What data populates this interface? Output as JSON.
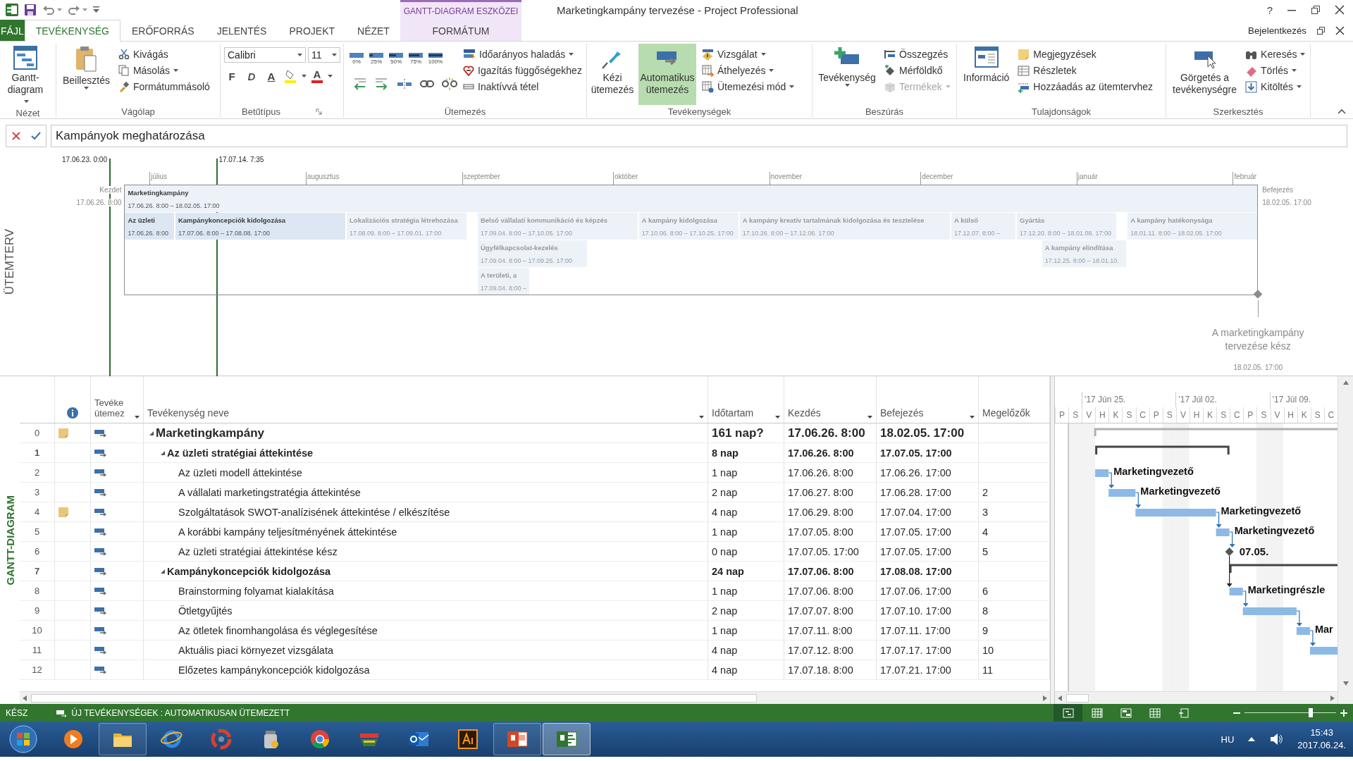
{
  "title_bar": {
    "contextual_label": "GANTT-DIAGRAM ESZKÖZEI",
    "title": "Marketingkampány tervezése - Project Professional",
    "help": "?"
  },
  "tabs": [
    {
      "label": "FÁJL",
      "kind": "file",
      "selected": false
    },
    {
      "label": "TEVÉKENYSÉG",
      "kind": "normal",
      "selected": true
    },
    {
      "label": "ERŐFORRÁS",
      "kind": "normal",
      "selected": false
    },
    {
      "label": "JELENTÉS",
      "kind": "normal",
      "selected": false
    },
    {
      "label": "PROJEKT",
      "kind": "normal",
      "selected": false
    },
    {
      "label": "NÉZET",
      "kind": "normal",
      "selected": false
    },
    {
      "label": "FORMÁTUM",
      "kind": "contextual",
      "selected": false
    }
  ],
  "account": "Bejelentkezés",
  "ribbon": [
    {
      "kind": "view",
      "label": "Nézet",
      "items": [
        {
          "label": "Gantt-diagram"
        }
      ]
    },
    {
      "kind": "clipboard",
      "label": "Vágólap",
      "items": [
        {
          "label": "Beillesztés"
        },
        {
          "label": "Kivágás"
        },
        {
          "label": "Másolás"
        },
        {
          "label": "Formátummásoló"
        }
      ]
    },
    {
      "kind": "font",
      "label": "Betűtípus",
      "font": "Calibri",
      "size": "11",
      "buttons": [
        "F",
        "D",
        "A"
      ],
      "font_color": "A"
    },
    {
      "kind": "schedule",
      "label": "Ütemezés",
      "progress": [
        "0%",
        "25%",
        "50%",
        "75%",
        "100%"
      ],
      "items": [
        {
          "label": "Időarányos haladás"
        },
        {
          "label": "Igazítás függőségekhez"
        },
        {
          "label": "Inaktívvá tétel"
        }
      ]
    },
    {
      "kind": "tasks",
      "label": "Tevékenységek",
      "modes": [
        {
          "label": "Kézi ütemezés",
          "selected": false
        },
        {
          "label": "Automatikus ütemezés",
          "selected": true
        }
      ],
      "items": [
        {
          "label": "Vizsgálat"
        },
        {
          "label": "Áthelyezés"
        },
        {
          "label": "Ütemezési mód"
        }
      ]
    },
    {
      "kind": "insert",
      "label": "Beszúrás",
      "large": "Tevékenység",
      "items": [
        {
          "label": "Összegzés",
          "disabled": false
        },
        {
          "label": "Mérföldkő",
          "disabled": false
        },
        {
          "label": "Termékek",
          "disabled": true
        }
      ]
    },
    {
      "kind": "properties",
      "label": "Tulajdonságok",
      "large": "Információ",
      "items": [
        {
          "label": "Megjegyzések"
        },
        {
          "label": "Részletek"
        },
        {
          "label": "Hozzáadás az ütemtervhez"
        }
      ]
    },
    {
      "kind": "editing",
      "label": "Szerkesztés",
      "large": "Görgetés a tevékenységre",
      "items": [
        {
          "label": "Keresés"
        },
        {
          "label": "Törlés"
        },
        {
          "label": "Kitöltés"
        }
      ]
    }
  ],
  "formula_bar": {
    "value": "Kampányok meghatározása"
  },
  "timeline": {
    "label": "ÜTEMTERV",
    "range_start": "17.06.23. 0:00",
    "range_end": "17.07.14. 7:35",
    "months": [
      "július",
      "augusztus",
      "szeptember",
      "október",
      "november",
      "december",
      "január",
      "február"
    ],
    "start_label": "Kezdet",
    "start_date": "17.06.26. 8:00",
    "finish_label": "Befejezés",
    "finish_date": "18.02.05. 17:00",
    "project": {
      "title": "Marketingkampány",
      "dates": "17.06.26. 8:00 – 18.02.05. 17:00"
    },
    "items": [
      {
        "title": "Az üzleti",
        "dates": "17.06.26. 8:00",
        "dimmed": false
      },
      {
        "title": "Kampánykoncepciók kidolgozása",
        "dates": "17.07.06. 8:00 – 17.08.08. 17:00",
        "dimmed": false
      },
      {
        "title": "Lokalizációs stratégia létrehozása",
        "dates": "17.08.09. 8:00 – 17.09.01. 17:00",
        "dimmed": true
      },
      {
        "title": "Belső vállalati kommunikáció és képzés",
        "dates": "17.09.04. 8:00 – 17.10.05. 17:00",
        "dimmed": true
      },
      {
        "title": "Ügyfélkapcsolat-kezelés",
        "dates": "17.09.04. 8:00 – 17.09.25. 17:00",
        "dimmed": true
      },
      {
        "title": "A területi, a",
        "dates": "17.09.04. 8:00 –",
        "dimmed": true
      },
      {
        "title": "A kampány kidolgozása",
        "dates": "17.10.06. 8:00 – 17.10.25. 17:00",
        "dimmed": true
      },
      {
        "title": "A kampány kreatív tartalmának kidolgozása és tesztelése",
        "dates": "17.10.26. 8:00 – 17.12.06. 17:00",
        "dimmed": true
      },
      {
        "title": "A külső",
        "dates": "17.12.07. 8:00 –",
        "dimmed": true
      },
      {
        "title": "Gyártás",
        "dates": "17.12.20. 8:00 – 18.01.08. 17:00",
        "dimmed": true
      },
      {
        "title": "A kampány elindítása",
        "dates": "17.12.25. 8:00 – 18.01.10.",
        "dimmed": true
      },
      {
        "title": "A kampány hatékonysága",
        "dates": "18.01.11. 8:00 – 18.02.05. 17:00",
        "dimmed": true
      }
    ],
    "milestone": {
      "title": "A marketingkampány tervezése kész",
      "date": "18.02.05. 17:00"
    }
  },
  "table": {
    "label": "GANTT-DIAGRAM",
    "columns": [
      {
        "kind": "info"
      },
      {
        "kind": "mode",
        "label": "Tevéke ütemez"
      },
      {
        "kind": "name",
        "label": "Tevékenység neve"
      },
      {
        "kind": "duration",
        "label": "Időtartam"
      },
      {
        "kind": "start",
        "label": "Kezdés"
      },
      {
        "kind": "finish",
        "label": "Befejezés"
      },
      {
        "kind": "pred",
        "label": "Megelőzők"
      }
    ],
    "rows": [
      {
        "id": "0",
        "name": "Marketingkampány",
        "duration": "161 nap?",
        "start": "17.06.26. 8:00",
        "finish": "18.02.05. 17:00",
        "kind": "project",
        "note": true,
        "expanded": true,
        "children": [
          {
            "id": "1",
            "name": "Az üzleti stratégiai áttekintése",
            "duration": "8 nap",
            "start": "17.06.26. 8:00",
            "finish": "17.07.05. 17:00",
            "kind": "summary",
            "note": false,
            "expanded": true,
            "children": [
              {
                "id": "2",
                "name": "Az üzleti modell áttekintése",
                "duration": "1 nap",
                "start": "17.06.26. 8:00",
                "finish": "17.06.26. 17:00",
                "kind": "task",
                "note": false,
                "bar_label": "Marketingvezető"
              },
              {
                "id": "3",
                "name": "A vállalati marketingstratégia áttekintése",
                "duration": "2 nap",
                "start": "17.06.27. 8:00",
                "finish": "17.06.28. 17:00",
                "pred": "2",
                "kind": "task",
                "note": false,
                "bar_label": "Marketingvezető"
              },
              {
                "id": "4",
                "name": "Szolgáltatások SWOT-analízisének áttekintése / elkészítése",
                "duration": "4 nap",
                "start": "17.06.29. 8:00",
                "finish": "17.07.04. 17:00",
                "pred": "3",
                "kind": "task",
                "note": true,
                "bar_label": "Marketingvezető"
              },
              {
                "id": "5",
                "name": "A korábbi kampány teljesítményének áttekintése",
                "duration": "1 nap",
                "start": "17.07.05. 8:00",
                "finish": "17.07.05. 17:00",
                "pred": "4",
                "kind": "task",
                "note": false,
                "bar_label": "Marketingvezető"
              },
              {
                "id": "6",
                "name": "Az üzleti stratégiai áttekintése kész",
                "duration": "0 nap",
                "start": "17.07.05. 17:00",
                "finish": "17.07.05. 17:00",
                "pred": "5",
                "kind": "milestone",
                "note": false,
                "bar_label": "07.05."
              }
            ]
          },
          {
            "id": "7",
            "name": "Kampánykoncepciók kidolgozása",
            "duration": "24 nap",
            "start": "17.07.06. 8:00",
            "finish": "17.08.08. 17:00",
            "kind": "summary",
            "note": false,
            "expanded": true,
            "children": [
              {
                "id": "8",
                "name": "Brainstorming folyamat kialakítása",
                "duration": "1 nap",
                "start": "17.07.06. 8:00",
                "finish": "17.07.06. 17:00",
                "pred": "6",
                "kind": "task",
                "note": false,
                "bar_label": "Marketingrészle"
              },
              {
                "id": "9",
                "name": "Ötletgyűjtés",
                "duration": "2 nap",
                "start": "17.07.07. 8:00",
                "finish": "17.07.10. 17:00",
                "pred": "8",
                "kind": "task",
                "note": false
              },
              {
                "id": "10",
                "name": "Az ötletek finomhangolása és véglegesítése",
                "duration": "1 nap",
                "start": "17.07.11. 8:00",
                "finish": "17.07.11. 17:00",
                "pred": "9",
                "kind": "task",
                "note": false,
                "bar_label": "Mar"
              },
              {
                "id": "11",
                "name": "Aktuális piaci környezet vizsgálata",
                "duration": "4 nap",
                "start": "17.07.12. 8:00",
                "finish": "17.07.17. 17:00",
                "pred": "10",
                "kind": "task",
                "note": false
              },
              {
                "id": "12",
                "name": "Előzetes kampánykoncepciók kidolgozása",
                "duration": "4 nap",
                "start": "17.07.18. 8:00",
                "finish": "17.07.21. 17:00",
                "pred": "11",
                "kind": "task",
                "note": false
              }
            ]
          }
        ]
      }
    ]
  },
  "gantt": {
    "weeks": [
      "'17 Jún 25.",
      "'17 Júl 02.",
      "'17 Júl 09."
    ],
    "days": [
      "P",
      "S",
      "V",
      "H",
      "K",
      "S",
      "C",
      "P",
      "S",
      "V",
      "H",
      "K",
      "S",
      "C",
      "P",
      "S",
      "V",
      "H",
      "K",
      "S",
      "C"
    ]
  },
  "status_bar": {
    "ready": "KÉSZ",
    "new_tasks": "ÚJ TEVÉKENYSÉGEK : AUTOMATIKUSAN ÜTEMEZETT",
    "views": [
      {
        "selected": true
      },
      {
        "selected": false
      },
      {
        "selected": false
      },
      {
        "selected": false
      },
      {
        "selected": false
      }
    ],
    "zoom": {
      "level": 0.72
    }
  },
  "taskbar": {
    "apps": [
      {
        "running": false,
        "selected": false
      },
      {
        "running": true,
        "selected": false
      },
      {
        "running": false,
        "selected": false
      },
      {
        "running": false,
        "selected": false
      },
      {
        "running": false,
        "selected": false
      },
      {
        "running": false,
        "selected": false
      },
      {
        "running": false,
        "selected": false
      },
      {
        "running": false,
        "selected": false
      },
      {
        "running": false,
        "selected": false
      },
      {
        "running": true,
        "selected": false
      },
      {
        "running": true,
        "selected": true
      }
    ],
    "language": "HU",
    "time": "15:43",
    "date": "2017.06.24."
  }
}
